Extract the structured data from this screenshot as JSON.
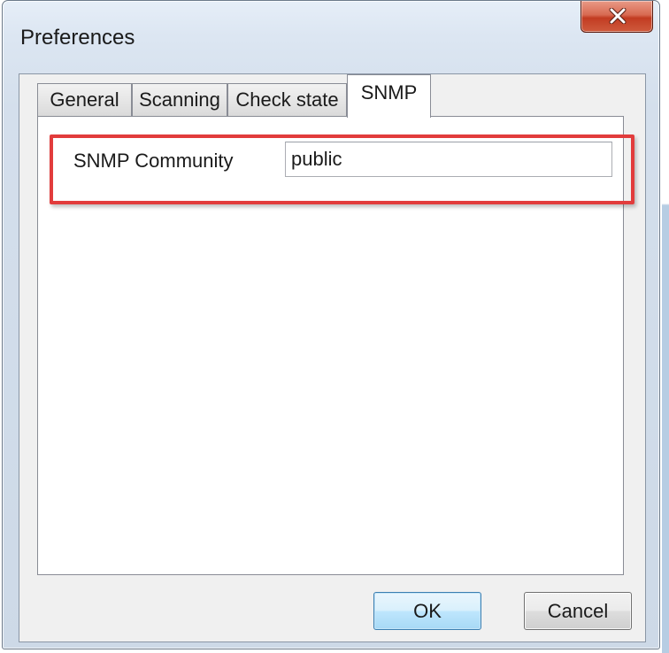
{
  "window": {
    "title": "Preferences"
  },
  "tabs": [
    {
      "label": "General",
      "active": false
    },
    {
      "label": "Scanning",
      "active": false
    },
    {
      "label": "Check state",
      "active": false
    },
    {
      "label": "SNMP",
      "active": true
    }
  ],
  "snmp": {
    "community_label": "SNMP Community",
    "community_value": "public"
  },
  "buttons": {
    "ok_label": "OK",
    "cancel_label": "Cancel"
  },
  "colors": {
    "highlight": "#e23c3c",
    "close_button": "#c23c22",
    "default_button_border": "#3c7fb1"
  },
  "icons": {
    "close": "close-icon"
  }
}
